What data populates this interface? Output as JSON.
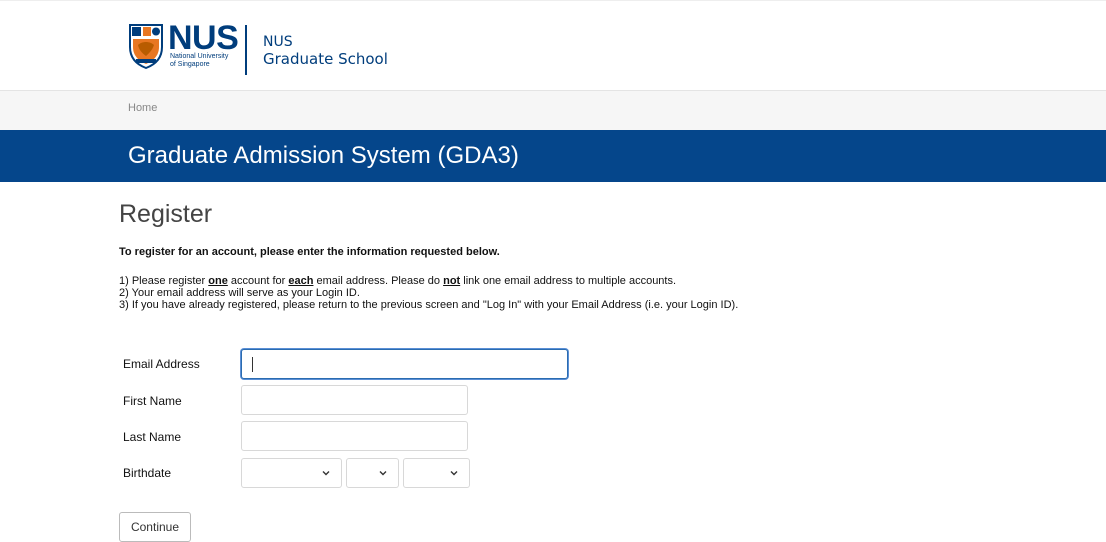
{
  "header": {
    "logo_main": "NUS",
    "logo_sub1": "National University",
    "logo_sub2": "of Singapore",
    "school_line1": "NUS",
    "school_line2": "Graduate School"
  },
  "breadcrumb": {
    "home": "Home"
  },
  "banner": {
    "title": "Graduate Admission System (GDA3)"
  },
  "page": {
    "title": "Register",
    "intro": "To register for an account, please enter the information requested below.",
    "note1_a": "1) Please register ",
    "note1_one": "one",
    "note1_b": " account for ",
    "note1_each": "each",
    "note1_c": " email address. Please do ",
    "note1_not": "not",
    "note1_d": " link one email address to multiple accounts.",
    "note2": "2) Your email address will serve as your Login ID.",
    "note3": "3) If you have already registered, please return to the previous screen and \"Log In\" with your Email Address (i.e. your Login ID)."
  },
  "form": {
    "email_label": "Email Address",
    "email_value": "",
    "first_name_label": "First Name",
    "first_name_value": "",
    "last_name_label": "Last Name",
    "last_name_value": "",
    "birthdate_label": "Birthdate",
    "birth_month_value": "",
    "birth_day_value": "",
    "birth_year_value": "",
    "continue_label": "Continue"
  },
  "colors": {
    "brand": "#05468b",
    "logo_blue": "#003d7c",
    "focus": "#2b6cb0"
  },
  "icons": [
    "nus-crest-icon",
    "chevron-down-icon"
  ]
}
